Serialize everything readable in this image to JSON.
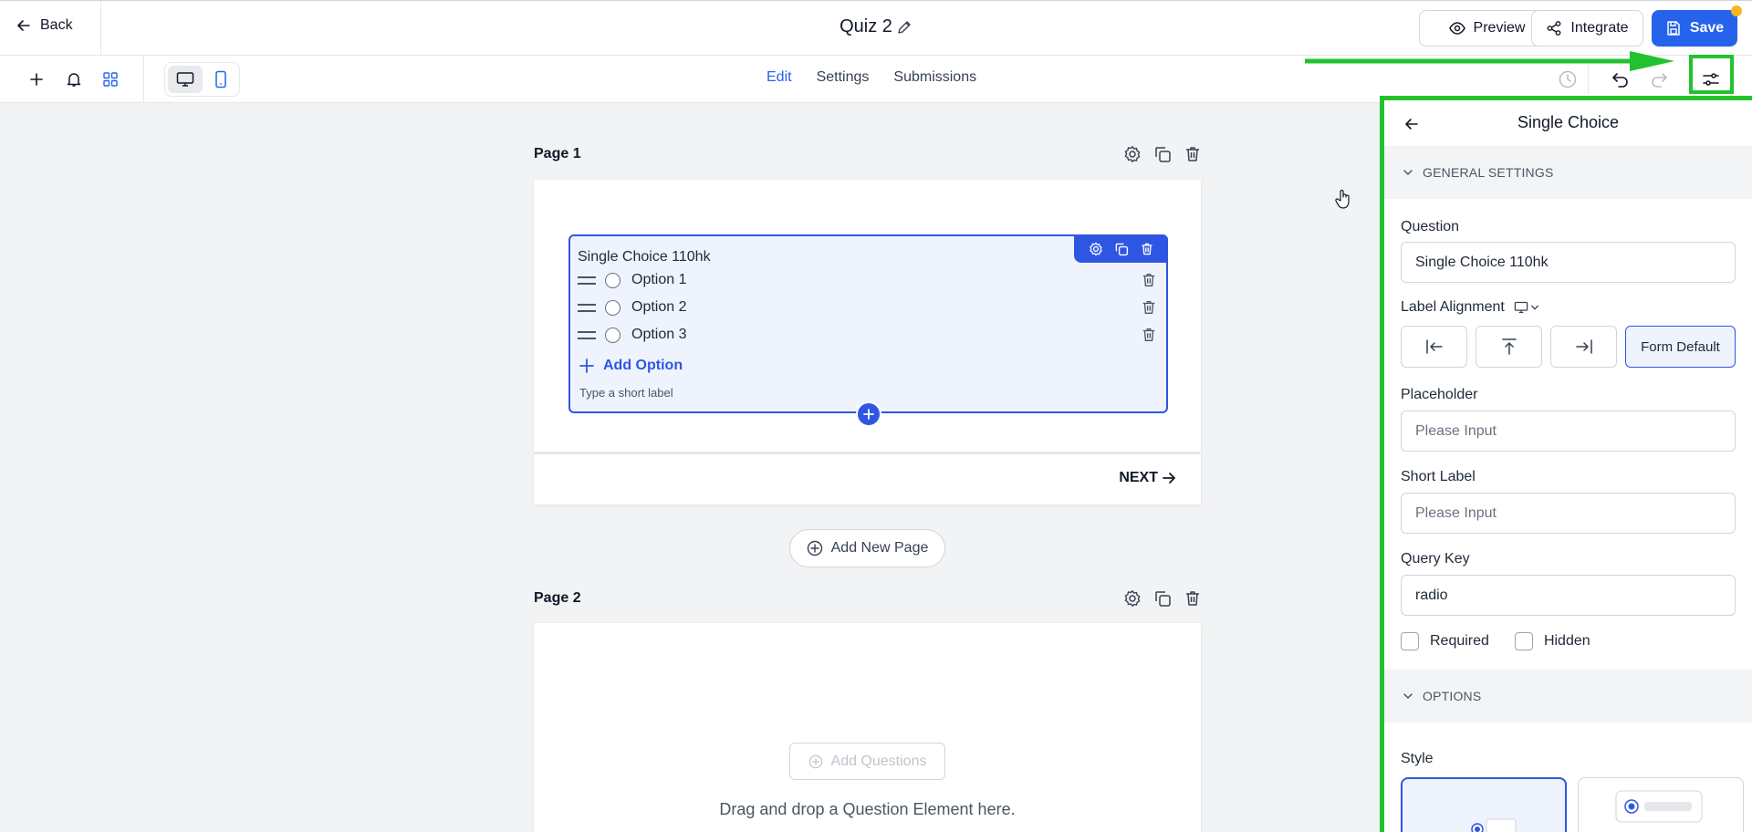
{
  "topbar": {
    "back_label": "Back",
    "title": "Quiz 2",
    "preview_label": "Preview",
    "integrate_label": "Integrate",
    "save_label": "Save"
  },
  "toolbar": {
    "tabs": [
      {
        "label": "Edit",
        "active": true
      },
      {
        "label": "Settings",
        "active": false
      },
      {
        "label": "Submissions",
        "active": false
      }
    ]
  },
  "canvas": {
    "page1": {
      "label": "Page 1",
      "question": {
        "title": "Single Choice 110hk",
        "options": [
          "Option 1",
          "Option 2",
          "Option 3"
        ],
        "add_option_label": "Add Option",
        "short_label_hint": "Type a short label"
      },
      "next_label": "NEXT"
    },
    "add_page_label": "Add New Page",
    "page2": {
      "label": "Page 2",
      "add_questions_label": "Add Questions",
      "drop_text": "Drag and drop a Question Element here."
    }
  },
  "panel": {
    "title": "Single Choice",
    "general_section": "GENERAL SETTINGS",
    "question_label": "Question",
    "question_value": "Single Choice 110hk",
    "label_alignment_label": "Label Alignment",
    "alignment_default": "Form Default",
    "placeholder_label": "Placeholder",
    "placeholder_value": "Please Input",
    "short_label_label": "Short Label",
    "short_label_value": "Please Input",
    "query_key_label": "Query Key",
    "query_key_value": "radio",
    "required_label": "Required",
    "hidden_label": "Hidden",
    "options_section": "OPTIONS",
    "style_label": "Style"
  },
  "colors": {
    "accent": "#2563eb",
    "highlight_green": "#22c22e",
    "save_dot": "#f5b71e"
  }
}
